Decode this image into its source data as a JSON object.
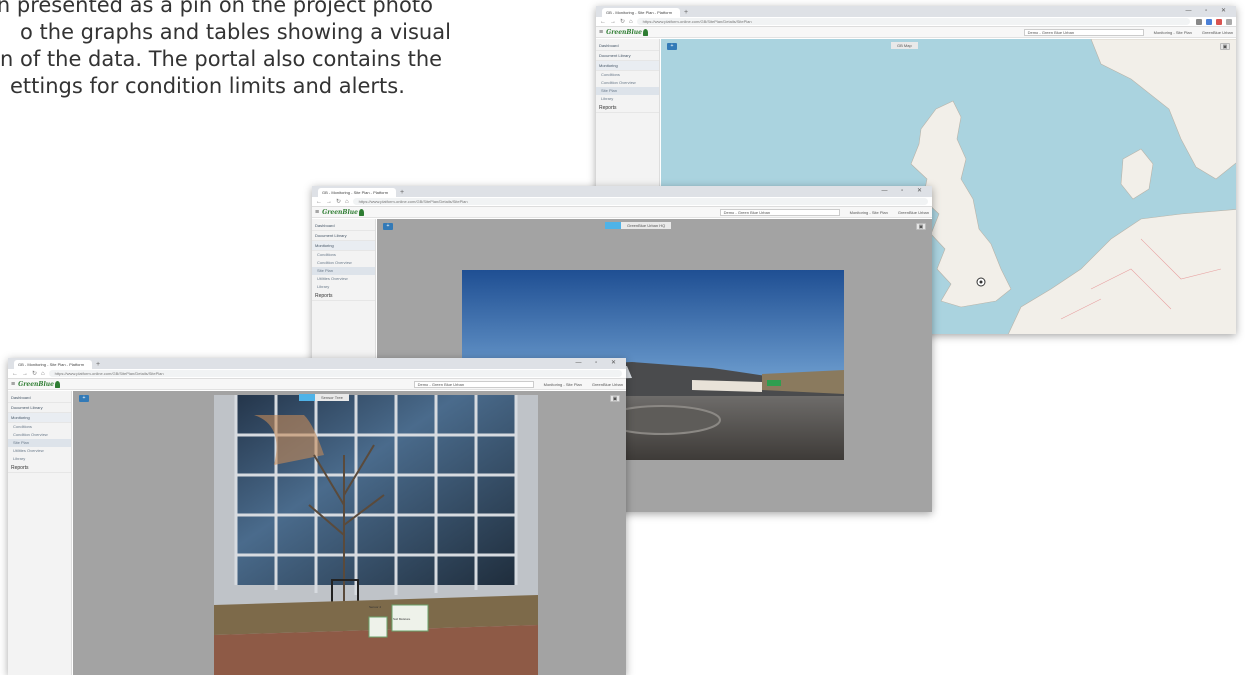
{
  "intro": {
    "line1": "again presented as a pin on the project photo",
    "line2": "o the graphs and tables showing a visual",
    "line3": "n of the data.  The portal also contains the",
    "line4": "ettings for condition limits and alerts."
  },
  "browser": {
    "tab_title": "GB - Monitoring - Site Plan - Platform",
    "new_tab": "+",
    "url": "https://www.platform-online.com/GB/SitePlan/Details/SitePlan"
  },
  "app": {
    "logo": "GreenBlue",
    "site_selector": "Demo - Green Blue Urban",
    "breadcrumb": "Monitoring - Site Plan",
    "user": "GreenBlue Urban",
    "sidebar": {
      "dashboard": "Dashboard",
      "document_library": "Document Library",
      "monitoring": "Monitoring",
      "conditions": "Conditions",
      "condition_overview": "Condition Overview",
      "site_plan": "Site Plan",
      "utilities_overview": "Utilities Overview",
      "library": "Library",
      "reports": "Reports"
    }
  },
  "views": {
    "map_view": "GB Map",
    "parking_view": "GreenBlue Urban HQ",
    "building_view": "Sensor Tree",
    "sensor_label": "Sensor 4",
    "info_label": "Soil Moisture"
  },
  "colors": {
    "accent_blue": "#337ab7",
    "camera_blue": "#4fb3e8",
    "brand_green": "#2e7d32",
    "sea": "#aad3df",
    "land": "#f2efe9"
  }
}
